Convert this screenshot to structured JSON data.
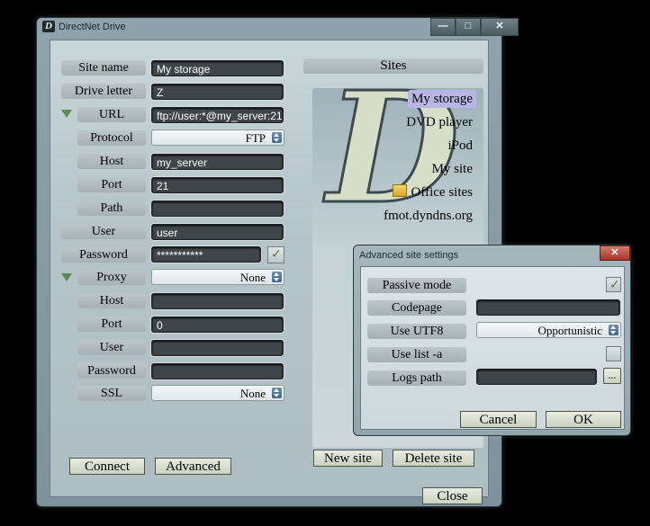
{
  "main_window": {
    "title": "DirectNet Drive",
    "logo_letter": "D",
    "caption": {
      "minimize": "—",
      "maximize": "□",
      "close": "✕"
    }
  },
  "form": {
    "site_name": {
      "label": "Site name",
      "value": "My storage"
    },
    "drive_letter": {
      "label": "Drive letter",
      "value": "Z"
    },
    "url": {
      "label": "URL",
      "value": "ftp://user:*@my_server:21"
    },
    "protocol": {
      "label": "Protocol",
      "value": "FTP"
    },
    "host": {
      "label": "Host",
      "value": "my_server"
    },
    "port": {
      "label": "Port",
      "value": "21"
    },
    "path": {
      "label": "Path",
      "value": ""
    },
    "user": {
      "label": "User",
      "value": "user"
    },
    "password": {
      "label": "Password",
      "value": "***********"
    },
    "proxy": {
      "label": "Proxy",
      "value": "None"
    },
    "proxy_host": {
      "label": "Host",
      "value": ""
    },
    "proxy_port": {
      "label": "Port",
      "value": "0"
    },
    "proxy_user": {
      "label": "User",
      "value": ""
    },
    "proxy_password": {
      "label": "Password",
      "value": ""
    },
    "ssl": {
      "label": "SSL",
      "value": "None"
    }
  },
  "buttons": {
    "connect": "Connect",
    "advanced": "Advanced",
    "close": "Close",
    "new_site": "New site",
    "delete_site": "Delete site"
  },
  "sites": {
    "header": "Sites",
    "logo_letter": "D",
    "items": [
      "My storage",
      "DVD player",
      "iPod",
      "My site",
      "Office sites",
      "fmot.dyndns.org"
    ],
    "selected": "My storage"
  },
  "dialog": {
    "title": "Advanced site settings",
    "close": "✕",
    "passive_mode": {
      "label": "Passive mode",
      "checked": true
    },
    "codepage": {
      "label": "Codepage",
      "value": ""
    },
    "use_utf8": {
      "label": "Use UTF8",
      "value": "Opportunistic"
    },
    "use_list_a": {
      "label": "Use list -a",
      "checked": false
    },
    "logs_path": {
      "label": "Logs path",
      "value": "",
      "browse": "..."
    },
    "cancel": "Cancel",
    "ok": "OK"
  },
  "colors": {
    "selected_site": "#b9b6e6",
    "check": "#5a7d3e"
  }
}
